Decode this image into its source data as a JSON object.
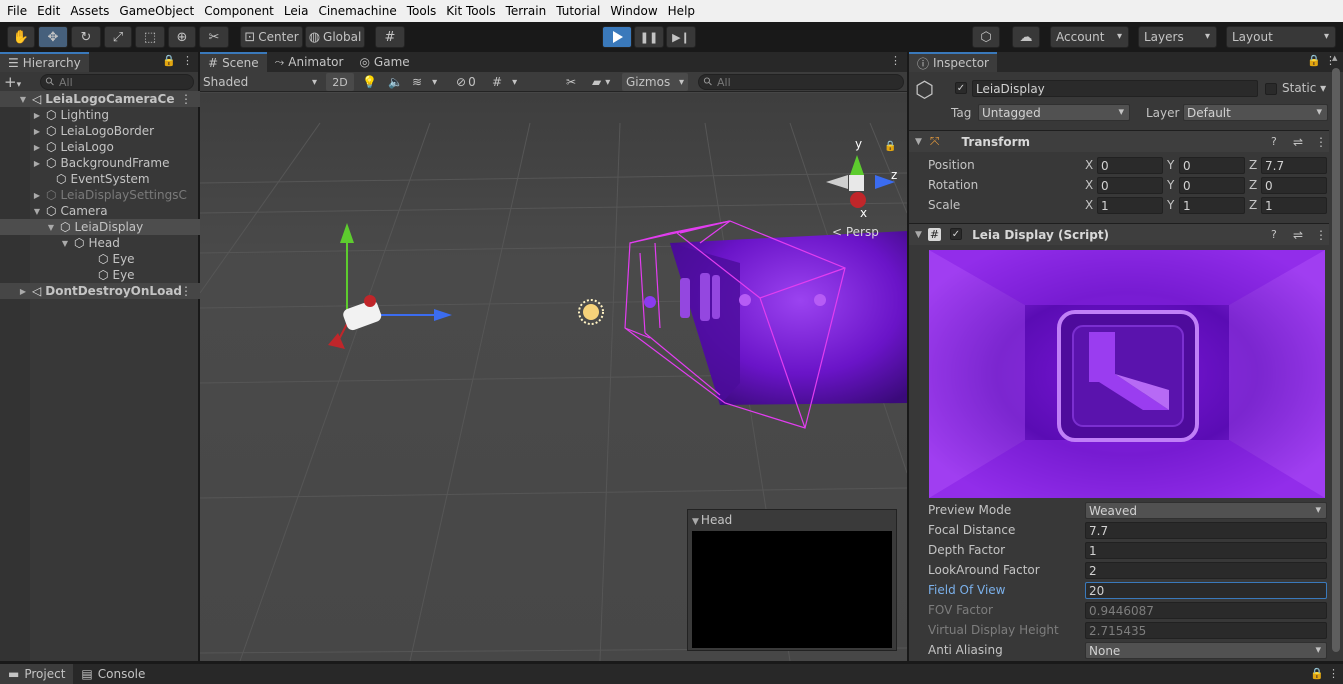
{
  "menu": [
    "File",
    "Edit",
    "Assets",
    "GameObject",
    "Component",
    "Leia",
    "Cinemachine",
    "Tools",
    "Kit Tools",
    "Terrain",
    "Tutorial",
    "Window",
    "Help"
  ],
  "toolbar": {
    "pivot_label": "Center",
    "space_label": "Global",
    "account_label": "Account",
    "layers_label": "Layers",
    "layout_label": "Layout"
  },
  "hierarchy": {
    "tab_label": "Hierarchy",
    "search_placeholder": "All",
    "add_label": "+",
    "rows": [
      {
        "label": "LeiaLogoCameraCe",
        "indent": 0,
        "arrow": "▼",
        "type": "scene"
      },
      {
        "label": "Lighting",
        "indent": 1,
        "arrow": "▶",
        "type": "obj"
      },
      {
        "label": "LeiaLogoBorder",
        "indent": 1,
        "arrow": "▶",
        "type": "obj"
      },
      {
        "label": "LeiaLogo",
        "indent": 1,
        "arrow": "▶",
        "type": "obj"
      },
      {
        "label": "BackgroundFrame",
        "indent": 1,
        "arrow": "▶",
        "type": "obj"
      },
      {
        "label": "EventSystem",
        "indent": 1,
        "arrow": "",
        "type": "obj"
      },
      {
        "label": "LeiaDisplaySettingsC",
        "indent": 1,
        "arrow": "▶",
        "type": "dim"
      },
      {
        "label": "Camera",
        "indent": 1,
        "arrow": "▼",
        "type": "obj"
      },
      {
        "label": "LeiaDisplay",
        "indent": 2,
        "arrow": "▼",
        "type": "sel"
      },
      {
        "label": "Head",
        "indent": 3,
        "arrow": "▼",
        "type": "obj"
      },
      {
        "label": "Eye",
        "indent": 4,
        "arrow": "",
        "type": "obj"
      },
      {
        "label": "Eye",
        "indent": 4,
        "arrow": "",
        "type": "obj"
      },
      {
        "label": "DontDestroyOnLoad",
        "indent": 0,
        "arrow": "▶",
        "type": "scene"
      }
    ]
  },
  "scene_tabs": {
    "scene": "Scene",
    "animator": "Animator",
    "game": "Game"
  },
  "scene_bar": {
    "shading_mode": "Shaded",
    "mode_2d": "2D",
    "hidden_count": "0",
    "gizmos": "Gizmos",
    "search_placeholder": "All"
  },
  "scene_gizmo": {
    "y": "y",
    "z": "z",
    "x": "x",
    "projection": "< Persp"
  },
  "camera_preview": {
    "title": "Head"
  },
  "inspector": {
    "tab_label": "Inspector",
    "object_name": "LeiaDisplay",
    "static_label": "Static",
    "tag_label": "Tag",
    "tag_value": "Untagged",
    "layer_label": "Layer",
    "layer_value": "Default",
    "transform": {
      "title": "Transform",
      "rows": [
        {
          "label": "Position",
          "x": "0",
          "y": "0",
          "z": "7.7"
        },
        {
          "label": "Rotation",
          "x": "0",
          "y": "0",
          "z": "0"
        },
        {
          "label": "Scale",
          "x": "1",
          "y": "1",
          "z": "1"
        }
      ]
    },
    "script": {
      "title": "Leia Display (Script)",
      "fields": [
        {
          "label": "Preview Mode",
          "value": "Weaved",
          "kind": "drop"
        },
        {
          "label": "Focal Distance",
          "value": "7.7",
          "kind": "input"
        },
        {
          "label": "Depth Factor",
          "value": "1",
          "kind": "input"
        },
        {
          "label": "LookAround Factor",
          "value": "2",
          "kind": "input"
        },
        {
          "label": "Field Of View",
          "value": "20",
          "kind": "focus"
        },
        {
          "label": "FOV Factor",
          "value": "0.9446087",
          "kind": "disabled"
        },
        {
          "label": "Virtual Display Height",
          "value": "2.715435",
          "kind": "disabled"
        },
        {
          "label": "Anti Aliasing",
          "value": "None",
          "kind": "drop"
        }
      ]
    }
  },
  "bottom_tabs": {
    "project": "Project",
    "console": "Console"
  },
  "colors": {
    "accent": "#3a79bb",
    "play_active": "#3a79bb",
    "purple": "#7a1fd6",
    "magenta": "#e23df0"
  }
}
